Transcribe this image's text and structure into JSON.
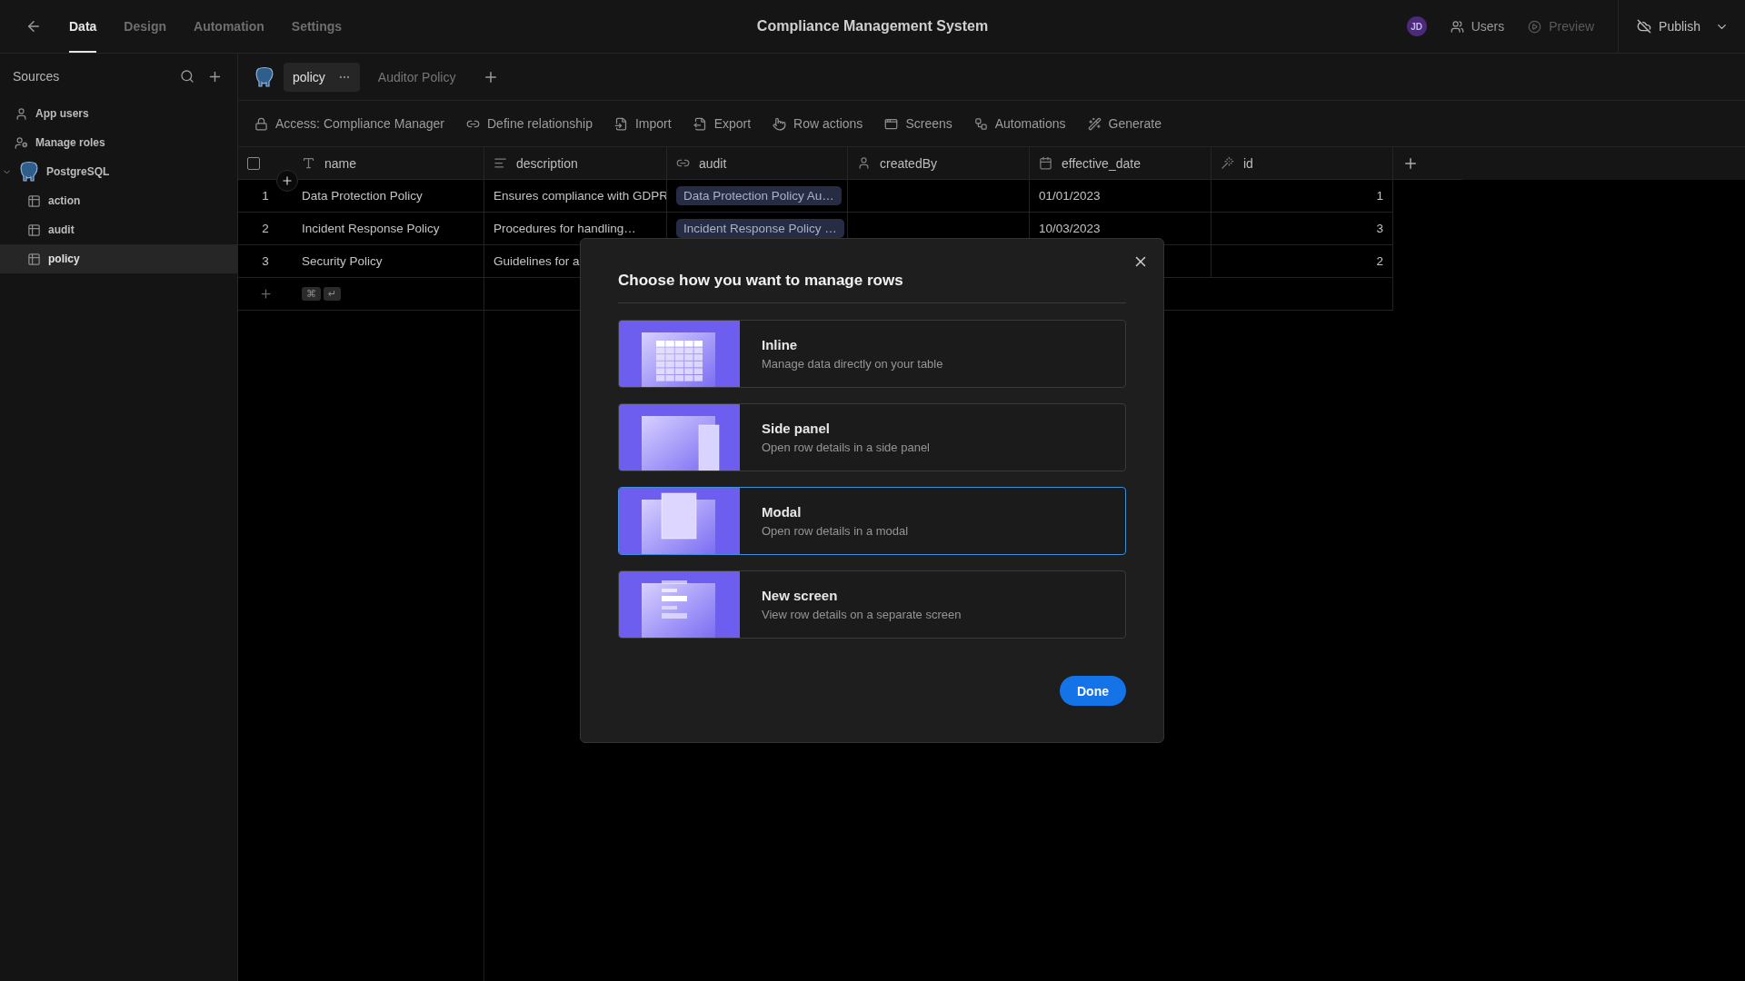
{
  "top_bar": {
    "tabs": [
      {
        "label": "Data",
        "selected": true
      },
      {
        "label": "Design",
        "selected": false
      },
      {
        "label": "Automation",
        "selected": false
      },
      {
        "label": "Settings",
        "selected": false
      }
    ],
    "title": "Compliance Management System",
    "avatar": "JD",
    "actions": [
      {
        "label": "Users",
        "kind": "users",
        "disabled": false
      },
      {
        "label": "Preview",
        "kind": "preview",
        "disabled": true
      }
    ],
    "publish": "Publish"
  },
  "sidebar": {
    "title": "Sources",
    "items": [
      {
        "label": "App users",
        "kind": "users",
        "selected": false
      },
      {
        "label": "Manage roles",
        "kind": "roles",
        "selected": false
      },
      {
        "label": "PostgreSQL",
        "kind": "database",
        "selected": false,
        "expanded": true,
        "children": [
          {
            "label": "action",
            "kind": "table",
            "selected": false
          },
          {
            "label": "audit",
            "kind": "table",
            "selected": false
          },
          {
            "label": "policy",
            "kind": "table",
            "selected": true
          }
        ]
      }
    ]
  },
  "tabs": [
    {
      "label": "policy",
      "selected": true
    },
    {
      "label": "Auditor Policy",
      "selected": false
    }
  ],
  "toolbar": [
    {
      "label": "Access: Compliance Manager",
      "kind": "lock"
    },
    {
      "label": "Define relationship",
      "kind": "relationship"
    },
    {
      "label": "Import",
      "kind": "import"
    },
    {
      "label": "Export",
      "kind": "export"
    },
    {
      "label": "Row actions",
      "kind": "pointer"
    },
    {
      "label": "Screens",
      "kind": "screens"
    },
    {
      "label": "Automations",
      "kind": "automations"
    },
    {
      "label": "Generate",
      "kind": "generate"
    }
  ],
  "table": {
    "select_all": {
      "checked": false
    },
    "columns": [
      {
        "label": "name",
        "kind": "text"
      },
      {
        "label": "description",
        "kind": "longtext"
      },
      {
        "label": "audit",
        "kind": "link"
      },
      {
        "label": "createdBy",
        "kind": "user"
      },
      {
        "label": "effective_date",
        "kind": "date"
      },
      {
        "label": "id",
        "kind": "auto"
      }
    ],
    "rows": [
      {
        "number": "1",
        "name": "Data Protection Policy",
        "description": "Ensures compliance with GDPR",
        "audit": "Data Protection Policy Au…",
        "effective_date": "01/01/2023",
        "id": "1"
      },
      {
        "number": "2",
        "name": "Incident Response Policy",
        "description": "Procedures for handling…",
        "audit": "Incident Response Policy …",
        "effective_date": "10/03/2023",
        "id": "3"
      },
      {
        "number": "3",
        "name": "Security Policy",
        "description": "Guidelines for a",
        "id": "2"
      }
    ],
    "add_row_keys": [
      "⌘",
      "↵"
    ]
  },
  "dialog": {
    "title": "Choose how you want to manage rows",
    "options": [
      {
        "kind": "inline",
        "title": "Inline",
        "description": "Manage data directly on your table",
        "selected": false
      },
      {
        "kind": "side-panel",
        "title": "Side panel",
        "description": "Open row details in a side panel",
        "selected": false
      },
      {
        "kind": "modal",
        "title": "Modal",
        "description": "Open row details in a modal",
        "selected": true
      },
      {
        "kind": "new-screen",
        "title": "New screen",
        "description": "View row details on a separate screen",
        "selected": false
      }
    ],
    "done": "Done"
  }
}
